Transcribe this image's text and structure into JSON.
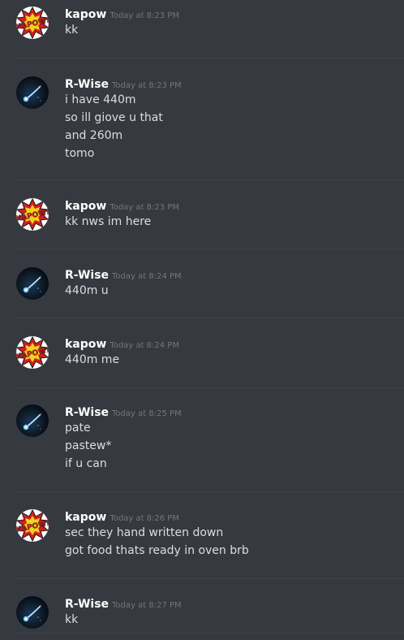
{
  "messages": [
    {
      "author": "kapow",
      "avatar": "kapow-comic-icon",
      "time": "Today at 8:23 PM",
      "lines": [
        "kk"
      ]
    },
    {
      "author": "R-Wise",
      "avatar": "blue-comet-icon",
      "time": "Today at 8:23 PM",
      "lines": [
        "i have 440m",
        "so ill giove u that",
        "and 260m",
        "tomo"
      ]
    },
    {
      "author": "kapow",
      "avatar": "kapow-comic-icon",
      "time": "Today at 8:23 PM",
      "lines": [
        "kk nws im here"
      ]
    },
    {
      "author": "R-Wise",
      "avatar": "blue-comet-icon",
      "time": "Today at 8:24 PM",
      "lines": [
        "440m u"
      ]
    },
    {
      "author": "kapow",
      "avatar": "kapow-comic-icon",
      "time": "Today at 8:24 PM",
      "lines": [
        "440m me"
      ]
    },
    {
      "author": "R-Wise",
      "avatar": "blue-comet-icon",
      "time": "Today at 8:25 PM",
      "lines": [
        "pate",
        "pastew*",
        "if u can"
      ]
    },
    {
      "author": "kapow",
      "avatar": "kapow-comic-icon",
      "time": "Today at 8:26 PM",
      "lines": [
        "sec they hand written down",
        "got food thats ready in oven brb"
      ]
    },
    {
      "author": "R-Wise",
      "avatar": "blue-comet-icon",
      "time": "Today at 8:27 PM",
      "lines": [
        "kk"
      ]
    }
  ],
  "avatar_text": {
    "kapow": "KAPOW!"
  },
  "colors": {
    "background": "#36393f",
    "username": "#ffffff",
    "timestamp": "#72767d",
    "message_text": "#dcddde",
    "divider": "#40434a"
  }
}
